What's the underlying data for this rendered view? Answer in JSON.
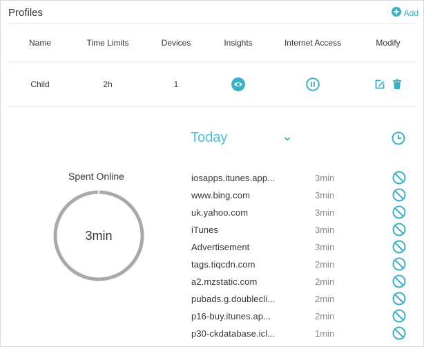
{
  "header": {
    "title": "Profiles",
    "add_label": "Add"
  },
  "table": {
    "columns": [
      "Name",
      "Time Limits",
      "Devices",
      "Insights",
      "Internet Access",
      "Modify"
    ],
    "rows": [
      {
        "name": "Child",
        "time_limits": "2h",
        "devices": "1",
        "insights_icon": "eye-icon",
        "internet_access_icon": "pause-icon",
        "modify_icons": [
          "edit-icon",
          "trash-icon"
        ]
      }
    ]
  },
  "insights": {
    "period": "Today",
    "spent_online_label": "Spent Online",
    "spent_online_value": "3min",
    "sites": [
      {
        "site": "iosapps.itunes.app...",
        "time": "3min"
      },
      {
        "site": "www.bing.com",
        "time": "3min"
      },
      {
        "site": "uk.yahoo.com",
        "time": "3min"
      },
      {
        "site": "iTunes",
        "time": "3min"
      },
      {
        "site": "Advertisement",
        "time": "3min"
      },
      {
        "site": "tags.tiqcdn.com",
        "time": "2min"
      },
      {
        "site": "a2.mzstatic.com",
        "time": "2min"
      },
      {
        "site": "pubads.g.doublecli...",
        "time": "2min"
      },
      {
        "site": "p16-buy.itunes.ap...",
        "time": "2min"
      },
      {
        "site": "p30-ckdatabase.icl...",
        "time": "1min"
      }
    ]
  },
  "colors": {
    "accent": "#3bb0c9",
    "ring": "#a9a9a9",
    "text": "#333333",
    "muted": "#8a8a8a"
  }
}
